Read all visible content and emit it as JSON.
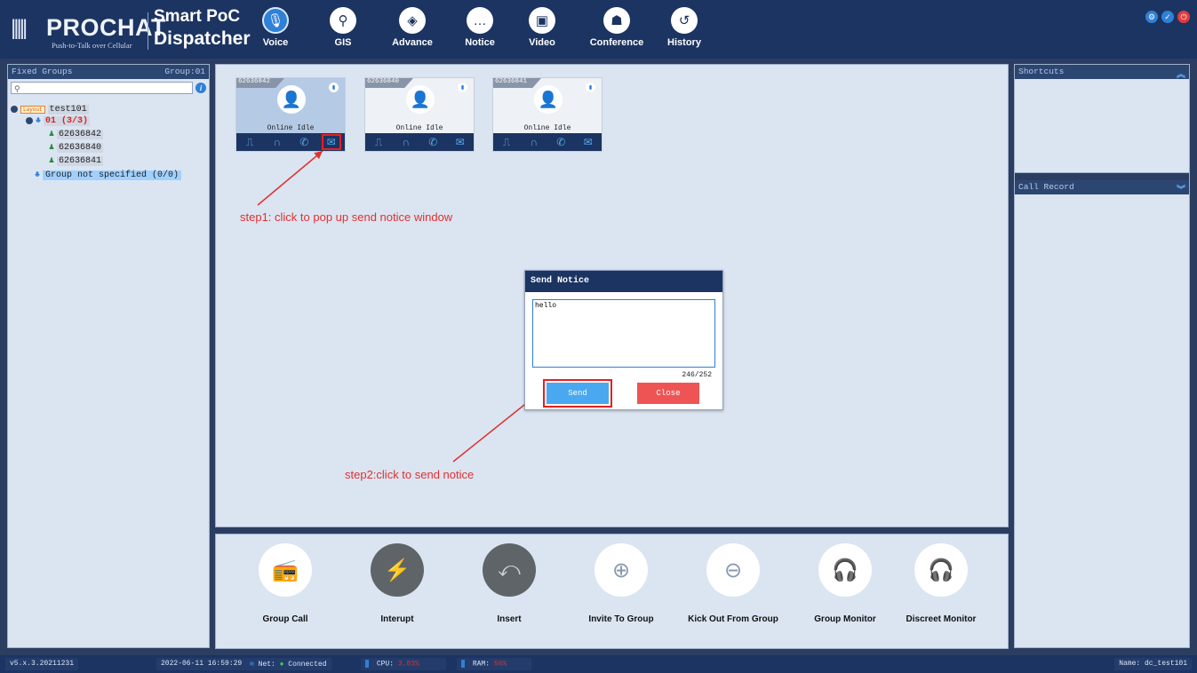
{
  "app": {
    "brand": "PROCHAT",
    "tagline": "Push-to-Talk over Cellular",
    "title_line1": "Smart PoC",
    "title_line2": "Dispatcher"
  },
  "nav": {
    "tabs": [
      {
        "label": "Voice",
        "icon": "microphone-icon",
        "active": true
      },
      {
        "label": "GIS",
        "icon": "map-pin-icon"
      },
      {
        "label": "Advance",
        "icon": "advance-icon"
      },
      {
        "label": "Notice",
        "icon": "chat-bubble-icon"
      },
      {
        "label": "Video",
        "icon": "video-icon"
      },
      {
        "label": "Conference",
        "icon": "conference-icon"
      },
      {
        "label": "History",
        "icon": "history-icon"
      }
    ]
  },
  "left_panel": {
    "title": "Fixed Groups",
    "group_count": "Group:01",
    "tree": {
      "root_badge": "Layout",
      "root": "test101",
      "group": "01 (3/3)",
      "members": [
        "62636842",
        "62636840",
        "62636841"
      ],
      "unassigned": "Group not specified (0/0)"
    }
  },
  "cards": [
    {
      "number": "62636842",
      "status": "Online Idle",
      "selected": true
    },
    {
      "number": "62636840",
      "status": "Online Idle",
      "selected": false
    },
    {
      "number": "62636841",
      "status": "Online Idle",
      "selected": false
    }
  ],
  "annotations": {
    "step1": "step1: click to pop up send notice window",
    "step2": "step2:click to send notice"
  },
  "dialog": {
    "title": "Send Notice",
    "message": "hello",
    "counter": "246/252",
    "send_label": "Send",
    "close_label": "Close"
  },
  "actions": [
    {
      "label": "Group Call",
      "style": "white"
    },
    {
      "label": "Interupt",
      "style": "dark"
    },
    {
      "label": "Insert",
      "style": "dark"
    },
    {
      "label": "Invite To Group",
      "style": "white"
    },
    {
      "label": "Kick Out From Group",
      "style": "white"
    },
    {
      "label": "Group Monitor",
      "style": "white"
    },
    {
      "label": "Discreet Monitor",
      "style": "white"
    }
  ],
  "right_panel": {
    "shortcuts_title": "Shortcuts",
    "call_record_title": "Call Record"
  },
  "status_bar": {
    "version": "v5.x.3.20211231",
    "datetime": "2022-06-11 16:59:29",
    "net_label": "Net:",
    "net_status": "Connected",
    "cpu_label": "CPU:",
    "cpu_value": "3.03%",
    "ram_label": "RAM:",
    "ram_value": "56%",
    "user": "Name: dc_test101"
  },
  "colors": {
    "top_bar": "#1c3462",
    "accent": "#2f80d8",
    "panel_bg": "#dbe5f1",
    "annotation": "#e03030",
    "send_button": "#4aa8f0",
    "close_button": "#ef5454"
  }
}
